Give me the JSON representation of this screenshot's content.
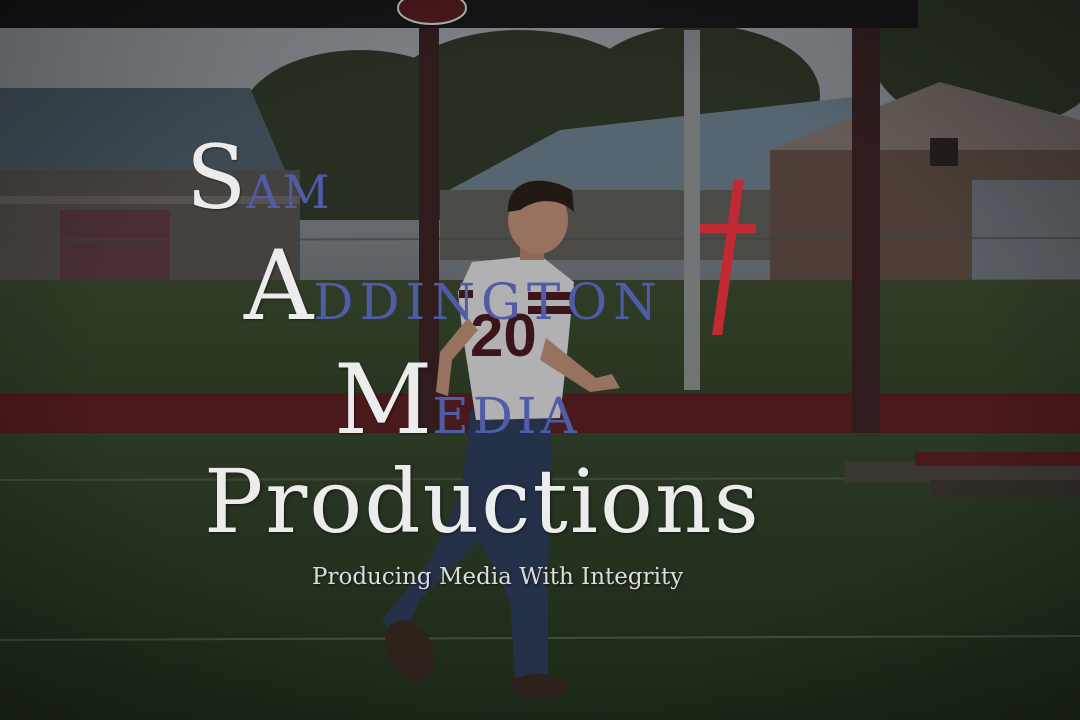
{
  "photo": {
    "jersey_number": "20",
    "colors": {
      "field_grass": "#2a3a26",
      "track": "#5a1f22",
      "sky": "#8f969c",
      "jersey": "#d8d8dc",
      "jersey_trim": "#4a1a22",
      "jeans": "#2d3c5a",
      "scoreboard": "#1a1a1d"
    }
  },
  "watermark": {
    "line1_initial": "S",
    "line1_rest": "AM",
    "line2_initial": "A",
    "line2_rest": "DDINGTON",
    "line3_initial": "M",
    "line3_rest": "EDIA",
    "line4": "Productions",
    "tagline": "Producing Media With Integrity",
    "colors": {
      "white": "#ececec",
      "blue": "#4f5ca6",
      "cross": "#c12a33"
    }
  }
}
